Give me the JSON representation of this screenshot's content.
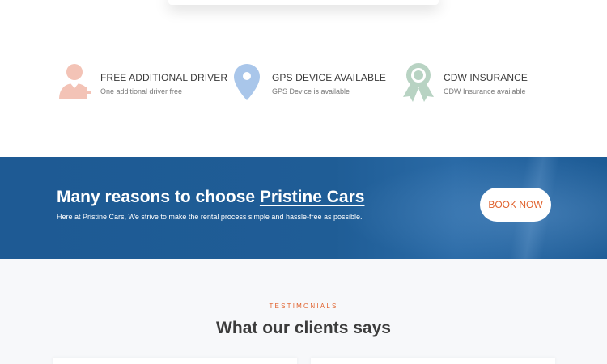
{
  "features": [
    {
      "title": "FREE ADDITIONAL DRIVER",
      "subtitle": "One additional driver free",
      "icon": "add-user-icon",
      "color": "#f3c3b6"
    },
    {
      "title": "GPS DEVICE AVAILABLE",
      "subtitle": "GPS Device is available",
      "icon": "map-pin-icon",
      "color": "#a9c6ea"
    },
    {
      "title": "CDW INSURANCE",
      "subtitle": "CDW Insurance available",
      "icon": "award-ribbon-icon",
      "color": "#b8d3c3"
    }
  ],
  "banner": {
    "headline_prefix": "Many reasons to choose ",
    "brand": "Pristine Cars",
    "tagline": "Here at Pristine Cars, We strive to make the rental process simple and hassle-free as possible.",
    "cta_label": "BOOK NOW",
    "background_color": "#1e5a94",
    "cta_text_color": "#e0622d"
  },
  "testimonials": {
    "kicker": "TESTIMONIALS",
    "heading": "What our clients says"
  }
}
